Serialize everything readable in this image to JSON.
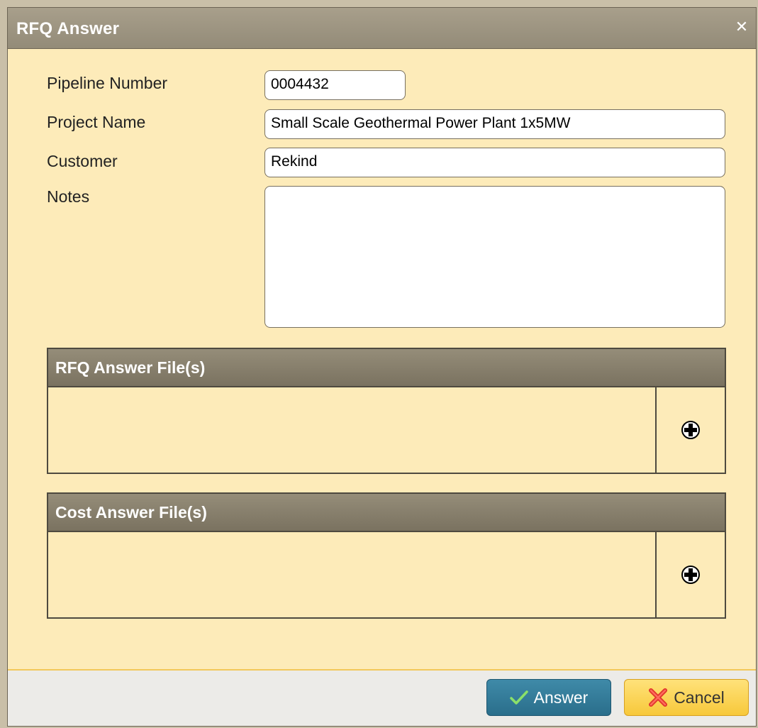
{
  "dialog": {
    "title": "RFQ Answer",
    "close_icon": "close-icon"
  },
  "form": {
    "pipeline_label": "Pipeline Number",
    "pipeline_value": "0004432",
    "project_label": "Project Name",
    "project_value": "Small Scale Geothermal Power Plant 1x5MW",
    "customer_label": "Customer",
    "customer_value": "Rekind",
    "notes_label": "Notes",
    "notes_value": ""
  },
  "panels": {
    "rfq_files_title": "RFQ Answer File(s)",
    "cost_files_title": "Cost Answer File(s)",
    "add_icon": "plus-icon"
  },
  "buttons": {
    "answer_label": "Answer",
    "cancel_label": "Cancel",
    "answer_icon": "checkmark-icon",
    "cancel_icon": "x-icon"
  },
  "colors": {
    "body_bg": "#fdebb9",
    "titlebar": "#9f9682",
    "answer_btn": "#2f7896",
    "cancel_btn": "#f9d356"
  }
}
